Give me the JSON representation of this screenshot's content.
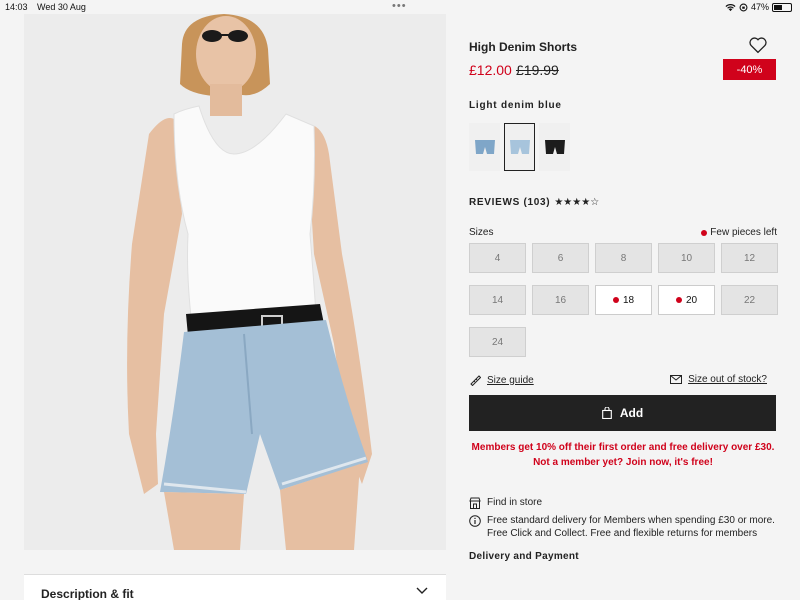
{
  "status_bar": {
    "time": "14:03",
    "date": "Wed 30 Aug",
    "battery": "47%",
    "battery_level": 0.47
  },
  "product": {
    "title": "High Denim Shorts",
    "price": "£12.00",
    "old_price": "£19.99",
    "discount": "-40%",
    "color_name": "Light denim blue",
    "swatches": [
      {
        "color": "#7fa6c8"
      },
      {
        "color": "#a7c4dc",
        "selected": true
      },
      {
        "color": "#1c1c1c"
      }
    ]
  },
  "reviews": {
    "label": "REVIEWS (103)",
    "stars": "★★★★☆",
    "rating": 4
  },
  "sizes": {
    "label": "Sizes",
    "few_left": "Few pieces left",
    "items": [
      {
        "label": "4"
      },
      {
        "label": "6"
      },
      {
        "label": "8"
      },
      {
        "label": "10"
      },
      {
        "label": "12"
      },
      {
        "label": "14"
      },
      {
        "label": "16"
      },
      {
        "label": "18"
      },
      {
        "label": "20"
      },
      {
        "label": "22"
      },
      {
        "label": "24"
      }
    ]
  },
  "links": {
    "size_guide": "Size guide",
    "size_out": "Size out of stock?"
  },
  "add_button": "Add",
  "promo": {
    "line1": "Members get 10% off their first order and free delivery over £30.",
    "line2": "Not a member yet? Join now, it's free!"
  },
  "find_in_store": "Find in store",
  "delivery_info": "Free standard delivery for Members when spending £30 or more. Free Click and Collect. Free and flexible returns for members",
  "delivery_payment": "Delivery and Payment",
  "description_fit": "Description & fit",
  "colors": {
    "sale_red": "#d0021b",
    "button_dark": "#222222"
  }
}
